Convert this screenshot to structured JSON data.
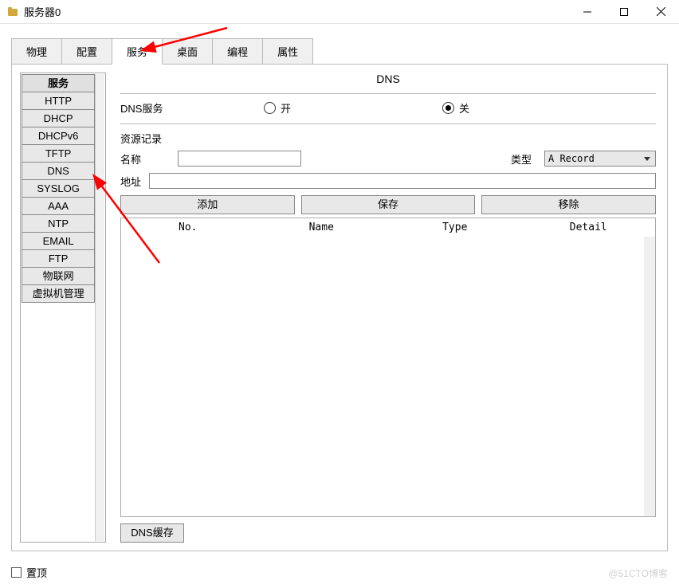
{
  "window": {
    "title": "服务器0"
  },
  "tabs": [
    "物理",
    "配置",
    "服务",
    "桌面",
    "编程",
    "属性"
  ],
  "active_tab_index": 2,
  "sidebar": {
    "header": "服务",
    "items": [
      "HTTP",
      "DHCP",
      "DHCPv6",
      "TFTP",
      "DNS",
      "SYSLOG",
      "AAA",
      "NTP",
      "EMAIL",
      "FTP",
      "物联网",
      "虚拟机管理"
    ]
  },
  "panel": {
    "title": "DNS",
    "service_label": "DNS服务",
    "radio_on": "开",
    "radio_off": "关",
    "radio_selected": "off",
    "resource_label": "资源记录",
    "name_label": "名称",
    "name_value": "",
    "type_label": "类型",
    "type_value": "A Record",
    "address_label": "地址",
    "address_value": "",
    "buttons": {
      "add": "添加",
      "save": "保存",
      "remove": "移除"
    },
    "table": {
      "headers": [
        "No.",
        "Name",
        "Type",
        "Detail"
      ]
    },
    "cache_button": "DNS缓存"
  },
  "footer": {
    "checkbox_label": "置顶",
    "checked": false
  },
  "watermark": "@51CTO博客"
}
